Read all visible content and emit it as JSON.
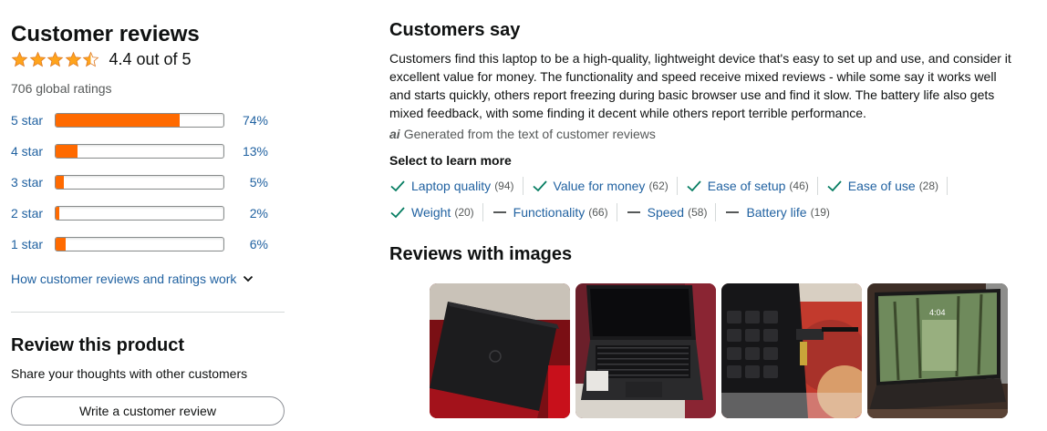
{
  "reviews": {
    "heading": "Customer reviews",
    "rating_text": "4.4 out of 5",
    "rating_value": 4.4,
    "global_ratings": "706 global ratings",
    "histogram": [
      {
        "label": "5 star",
        "pct": "74%",
        "fraction": 0.74
      },
      {
        "label": "4 star",
        "pct": "13%",
        "fraction": 0.13
      },
      {
        "label": "3 star",
        "pct": "5%",
        "fraction": 0.05
      },
      {
        "label": "2 star",
        "pct": "2%",
        "fraction": 0.02
      },
      {
        "label": "1 star",
        "pct": "6%",
        "fraction": 0.06
      }
    ],
    "how_link": "How customer reviews and ratings work"
  },
  "review_product": {
    "heading": "Review this product",
    "subtext": "Share your thoughts with other customers",
    "button": "Write a customer review"
  },
  "customers_say": {
    "heading": "Customers say",
    "summary": "Customers find this laptop to be a high-quality, lightweight device that's easy to set up and use, and consider it excellent value for money. The functionality and speed receive mixed reviews - while some say it works well and starts quickly, others report freezing during basic browser use and find it slow. The battery life also gets mixed feedback, with some finding it decent while others report terrible performance.",
    "ai_icon": "ai",
    "ai_note": "Generated from the text of customer reviews",
    "select_label": "Select to learn more",
    "aspects_row1": [
      {
        "label": "Laptop quality",
        "count": "(94)",
        "sentiment": "positive"
      },
      {
        "label": "Value for money",
        "count": "(62)",
        "sentiment": "positive"
      },
      {
        "label": "Ease of setup",
        "count": "(46)",
        "sentiment": "positive"
      },
      {
        "label": "Ease of use",
        "count": "(28)",
        "sentiment": "positive"
      }
    ],
    "aspects_row2": [
      {
        "label": "Weight",
        "count": "(20)",
        "sentiment": "positive"
      },
      {
        "label": "Functionality",
        "count": "(66)",
        "sentiment": "mixed"
      },
      {
        "label": "Speed",
        "count": "(58)",
        "sentiment": "mixed"
      },
      {
        "label": "Battery life",
        "count": "(19)",
        "sentiment": "mixed"
      }
    ]
  },
  "images": {
    "heading": "Reviews with images",
    "thumb_clock": "4:04"
  },
  "colors": {
    "star": "#ffa41c",
    "bar_fill": "#ff6a00",
    "link": "#2162a1",
    "check": "#067d62"
  }
}
